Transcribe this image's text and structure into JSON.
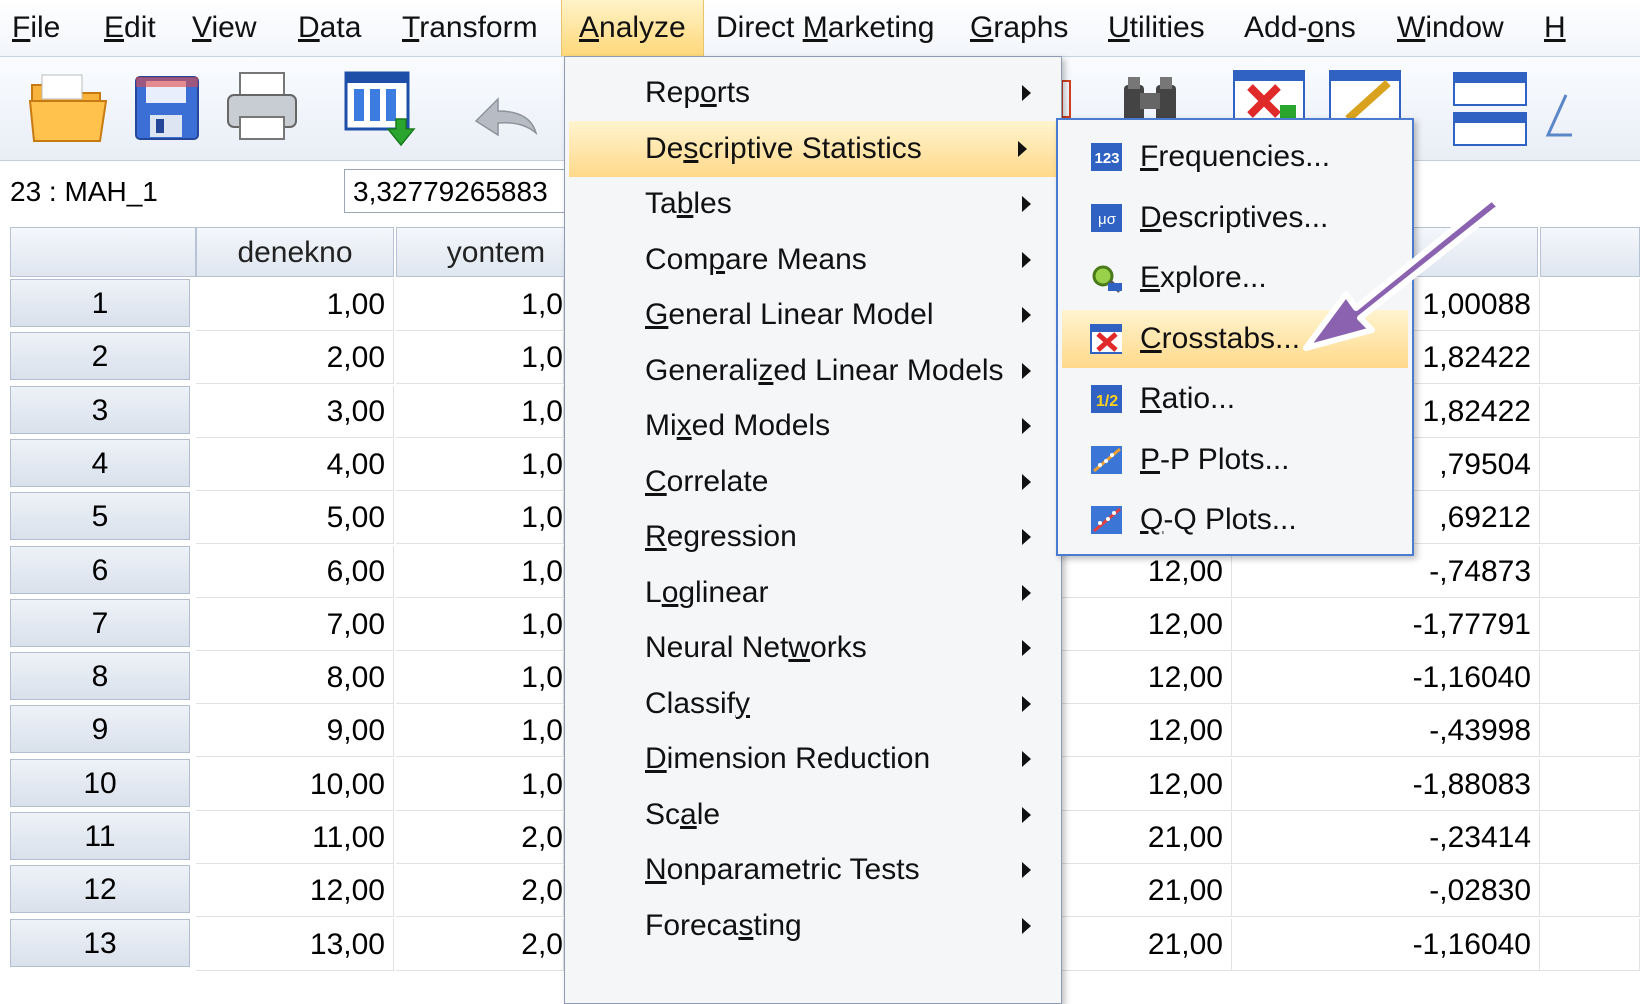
{
  "menubar": {
    "items": [
      {
        "label": "File",
        "ul": "F",
        "rest": "ile"
      },
      {
        "label": "Edit",
        "ul": "E",
        "rest": "dit"
      },
      {
        "label": "View",
        "ul": "V",
        "rest": "iew"
      },
      {
        "label": "Data",
        "ul": "D",
        "rest": "ata"
      },
      {
        "label": "Transform",
        "ul": "T",
        "rest": "ransform"
      },
      {
        "label": "Analyze",
        "ul": "A",
        "rest": "nalyze"
      },
      {
        "label": "Direct Marketing",
        "pre": "Direct ",
        "ul": "M",
        "rest": "arketing"
      },
      {
        "label": "Graphs",
        "ul": "G",
        "rest": "raphs"
      },
      {
        "label": "Utilities",
        "ul": "U",
        "rest": "tilities"
      },
      {
        "label": "Add-ons",
        "pre": "Add-",
        "ul": "o",
        "rest": "ns"
      },
      {
        "label": "Window",
        "ul": "W",
        "rest": "indow"
      },
      {
        "label": "H",
        "ul": "H",
        "rest": ""
      }
    ]
  },
  "cell_info": {
    "ref": "23 : MAH_1",
    "value": "3,32779265883"
  },
  "grid": {
    "columns": [
      "denekno",
      "yontem"
    ],
    "rows": [
      {
        "n": "1",
        "denekno": "1,00",
        "yontem": "1,0",
        "c3": "",
        "c4": "1,00088"
      },
      {
        "n": "2",
        "denekno": "2,00",
        "yontem": "1,0",
        "c3": "",
        "c4": "1,82422"
      },
      {
        "n": "3",
        "denekno": "3,00",
        "yontem": "1,0",
        "c3": "",
        "c4": "1,82422"
      },
      {
        "n": "4",
        "denekno": "4,00",
        "yontem": "1,0",
        "c3": "",
        "c4": ",79504"
      },
      {
        "n": "5",
        "denekno": "5,00",
        "yontem": "1,0",
        "c3": "",
        "c4": ",69212"
      },
      {
        "n": "6",
        "denekno": "6,00",
        "yontem": "1,0",
        "c3": "12,00",
        "c4": "-,74873"
      },
      {
        "n": "7",
        "denekno": "7,00",
        "yontem": "1,0",
        "c3": "12,00",
        "c4": "-1,77791"
      },
      {
        "n": "8",
        "denekno": "8,00",
        "yontem": "1,0",
        "c3": "12,00",
        "c4": "-1,16040"
      },
      {
        "n": "9",
        "denekno": "9,00",
        "yontem": "1,0",
        "c3": "12,00",
        "c4": "-,43998"
      },
      {
        "n": "10",
        "denekno": "10,00",
        "yontem": "1,0",
        "c3": "12,00",
        "c4": "-1,88083"
      },
      {
        "n": "11",
        "denekno": "11,00",
        "yontem": "2,0",
        "c3": "21,00",
        "c4": "-,23414"
      },
      {
        "n": "12",
        "denekno": "12,00",
        "yontem": "2,0",
        "c3": "21,00",
        "c4": "-,02830"
      },
      {
        "n": "13",
        "denekno": "13,00",
        "yontem": "2,0",
        "c3": "21,00",
        "c4": "-1,16040"
      }
    ]
  },
  "analyze_menu": {
    "items": [
      {
        "pre": "Rep",
        "ul": "o",
        "rest": "rts",
        "label": "Reports"
      },
      {
        "pre": "De",
        "ul": "s",
        "rest": "criptive Statistics",
        "label": "Descriptive Statistics",
        "highlighted": true
      },
      {
        "pre": "Ta",
        "ul": "b",
        "rest": "les",
        "label": "Tables"
      },
      {
        "pre": "Com",
        "ul": "p",
        "rest": "are Means",
        "label": "Compare Means"
      },
      {
        "pre": "",
        "ul": "G",
        "rest": "eneral Linear Model",
        "label": "General Linear Model"
      },
      {
        "pre": "Generali",
        "ul": "z",
        "rest": "ed Linear Models",
        "label": "Generalized Linear Models"
      },
      {
        "pre": "Mi",
        "ul": "x",
        "rest": "ed Models",
        "label": "Mixed Models"
      },
      {
        "pre": "",
        "ul": "C",
        "rest": "orrelate",
        "label": "Correlate"
      },
      {
        "pre": "",
        "ul": "R",
        "rest": "egression",
        "label": "Regression"
      },
      {
        "pre": "L",
        "ul": "o",
        "rest": "glinear",
        "label": "Loglinear"
      },
      {
        "pre": "Neural Net",
        "ul": "w",
        "rest": "orks",
        "label": "Neural Networks"
      },
      {
        "pre": "Classif",
        "ul": "y",
        "rest": "",
        "label": "Classify"
      },
      {
        "pre": "",
        "ul": "D",
        "rest": "imension Reduction",
        "label": "Dimension Reduction"
      },
      {
        "pre": "Sc",
        "ul": "a",
        "rest": "le",
        "label": "Scale"
      },
      {
        "pre": "",
        "ul": "N",
        "rest": "onparametric Tests",
        "label": "Nonparametric Tests"
      },
      {
        "pre": "Foreca",
        "ul": "s",
        "rest": "ting",
        "label": "Forecasting"
      }
    ]
  },
  "descriptive_submenu": {
    "items": [
      {
        "pre": "",
        "ul": "F",
        "rest": "requencies...",
        "label": "Frequencies...",
        "icon": "frequencies-icon",
        "icon_text": "123"
      },
      {
        "pre": "",
        "ul": "D",
        "rest": "escriptives...",
        "label": "Descriptives...",
        "icon": "descriptives-icon",
        "icon_text": "μσ"
      },
      {
        "pre": "",
        "ul": "E",
        "rest": "xplore...",
        "label": "Explore...",
        "icon": "explore-icon"
      },
      {
        "pre": "",
        "ul": "C",
        "rest": "rosstabs...",
        "label": "Crosstabs...",
        "icon": "crosstabs-icon",
        "highlighted": true
      },
      {
        "pre": "",
        "ul": "R",
        "rest": "atio...",
        "label": "Ratio...",
        "icon": "ratio-icon",
        "icon_text": "1/2"
      },
      {
        "pre": "",
        "ul": "P",
        "rest": "-P Plots...",
        "label": "P-P Plots...",
        "icon": "pp-plots-icon"
      },
      {
        "pre": "",
        "ul": "Q",
        "rest": "-Q Plots...",
        "label": "Q-Q Plots...",
        "icon": "qq-plots-icon"
      }
    ]
  },
  "colors": {
    "highlight": "#ffd98a",
    "annotation_arrow": "#8a62b0",
    "submenu_border": "#4a7bd0"
  }
}
